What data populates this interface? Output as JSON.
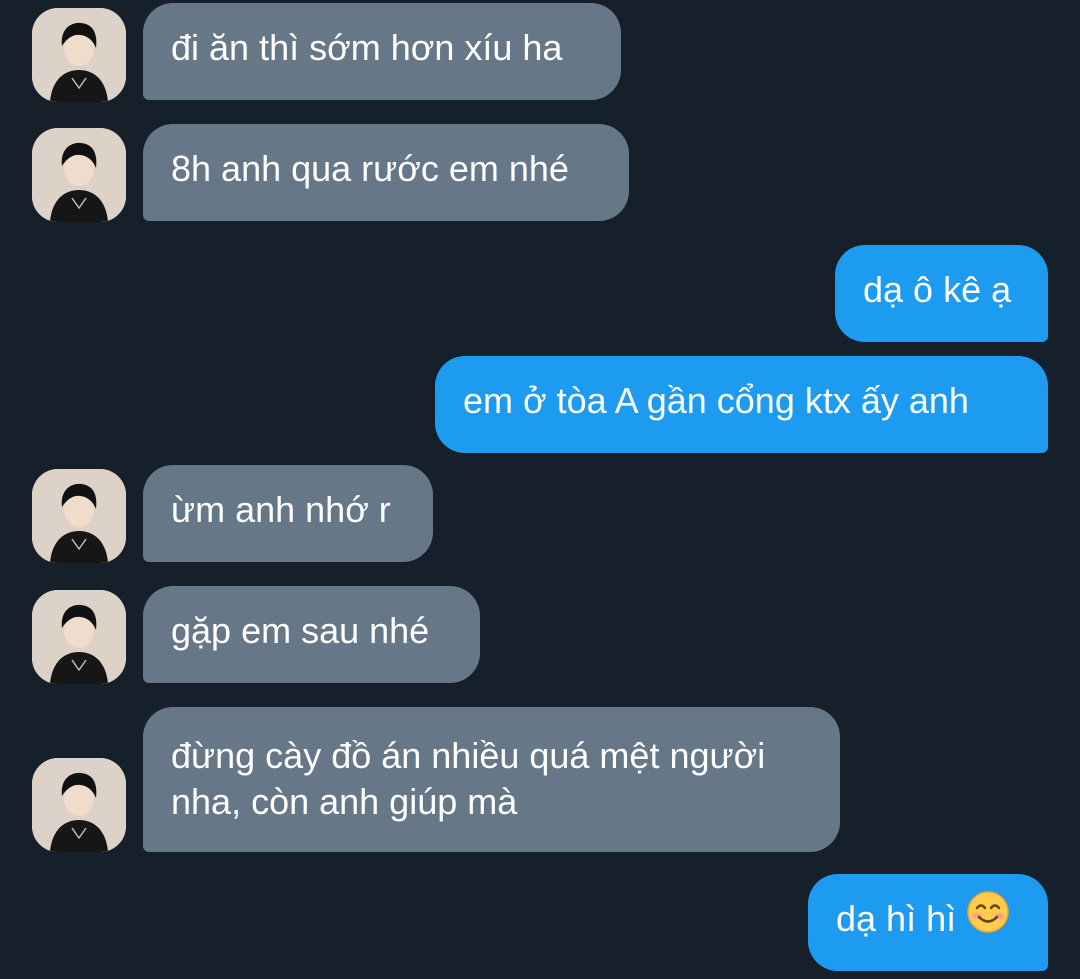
{
  "conversation": {
    "messages": [
      {
        "from": "them",
        "text": "đi ăn thì sớm hơn xíu ha"
      },
      {
        "from": "them",
        "text": "8h anh qua rước em nhé"
      },
      {
        "from": "me",
        "text": "dạ ô kê ạ"
      },
      {
        "from": "me",
        "text": "em ở tòa A gần cổng ktx ấy anh"
      },
      {
        "from": "them",
        "text": "ừm anh nhớ r"
      },
      {
        "from": "them",
        "text": "gặp em sau nhé"
      },
      {
        "from": "them",
        "text": "đừng cày đồ án nhiều quá mệt người nha, còn anh giúp mà"
      },
      {
        "from": "me",
        "text": "dạ hì hì",
        "emoji": "smiling-face-emoji"
      }
    ]
  },
  "colors": {
    "background": "#16202b",
    "incoming_bubble": "#667788",
    "outgoing_bubble": "#1d9bf0",
    "text": "#ffffff"
  },
  "icons": {
    "avatar": "contact-avatar-photo",
    "emoji": "smiling-face-emoji"
  }
}
